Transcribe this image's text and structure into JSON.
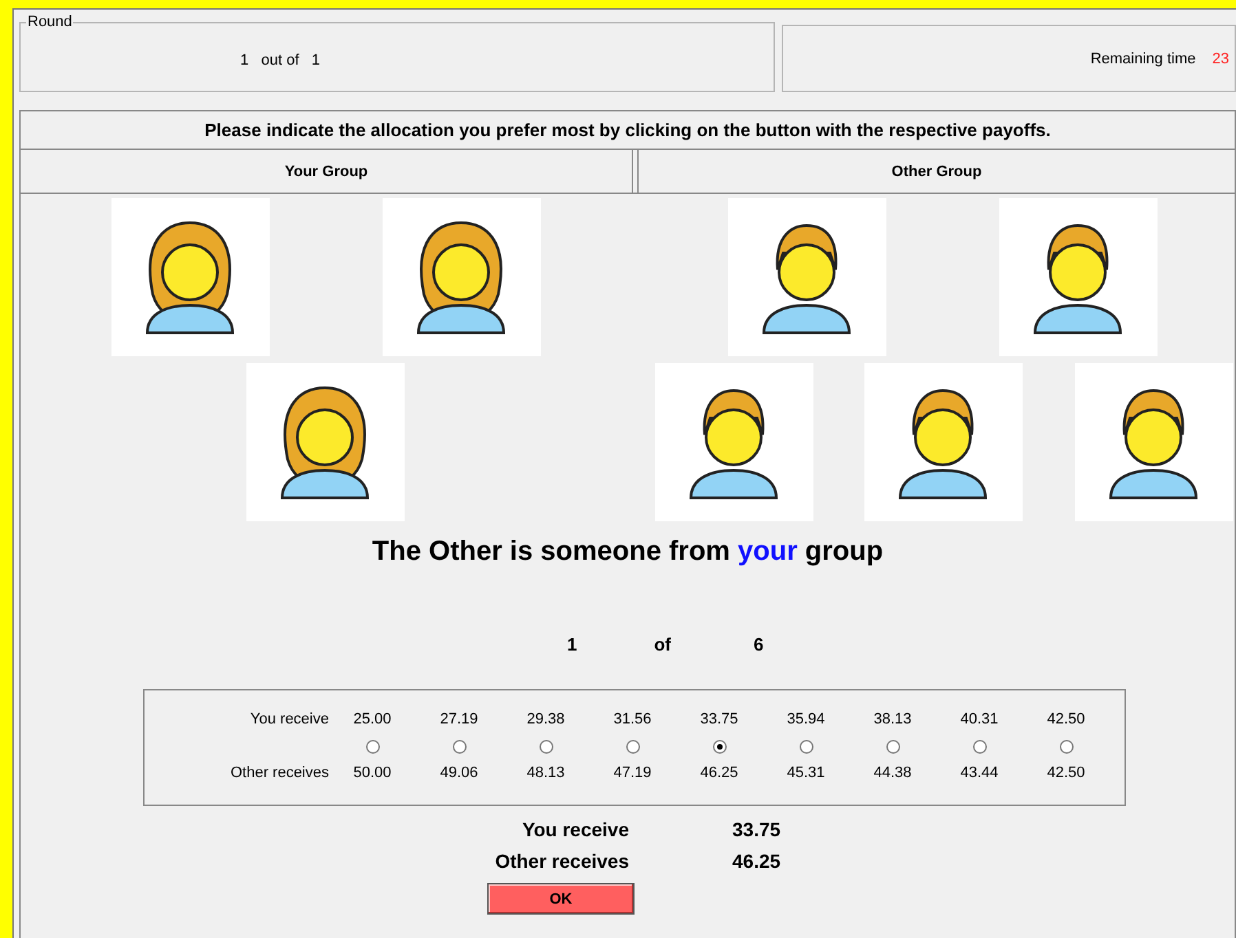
{
  "round": {
    "legend": "Round",
    "current": "1",
    "separator": "out of",
    "total": "1"
  },
  "timer": {
    "label": "Remaining time",
    "value": "23"
  },
  "instruction": "Please indicate the allocation you prefer most by clicking on the button with the respective payoffs.",
  "groups": [
    "Your Group",
    "Other Group"
  ],
  "avatar_rows": [
    [
      {
        "kind": "woman"
      },
      {
        "kind": "woman"
      },
      {
        "kind": "man"
      },
      {
        "kind": "man"
      }
    ],
    [
      {
        "kind": "woman"
      },
      {
        "kind": "man"
      },
      {
        "kind": "man"
      },
      {
        "kind": "man"
      }
    ]
  ],
  "caption": {
    "before": "The Other is someone from",
    "highlight": "your",
    "after": "group"
  },
  "progress": {
    "current": "1",
    "separator": "of",
    "total": "6"
  },
  "choices": {
    "row_labels": [
      "You receive",
      "Other receives"
    ],
    "options": [
      {
        "you": "25.00",
        "other": "50.00",
        "selected": false
      },
      {
        "you": "27.19",
        "other": "49.06",
        "selected": false
      },
      {
        "you": "29.38",
        "other": "48.13",
        "selected": false
      },
      {
        "you": "31.56",
        "other": "47.19",
        "selected": false
      },
      {
        "you": "33.75",
        "other": "46.25",
        "selected": true
      },
      {
        "you": "35.94",
        "other": "45.31",
        "selected": false
      },
      {
        "you": "38.13",
        "other": "44.38",
        "selected": false
      },
      {
        "you": "40.31",
        "other": "43.44",
        "selected": false
      },
      {
        "you": "42.50",
        "other": "42.50",
        "selected": false
      }
    ]
  },
  "summary": [
    {
      "label": "You receive",
      "value": "33.75"
    },
    {
      "label": "Other receives",
      "value": "46.25"
    }
  ],
  "ok_button": "OK"
}
